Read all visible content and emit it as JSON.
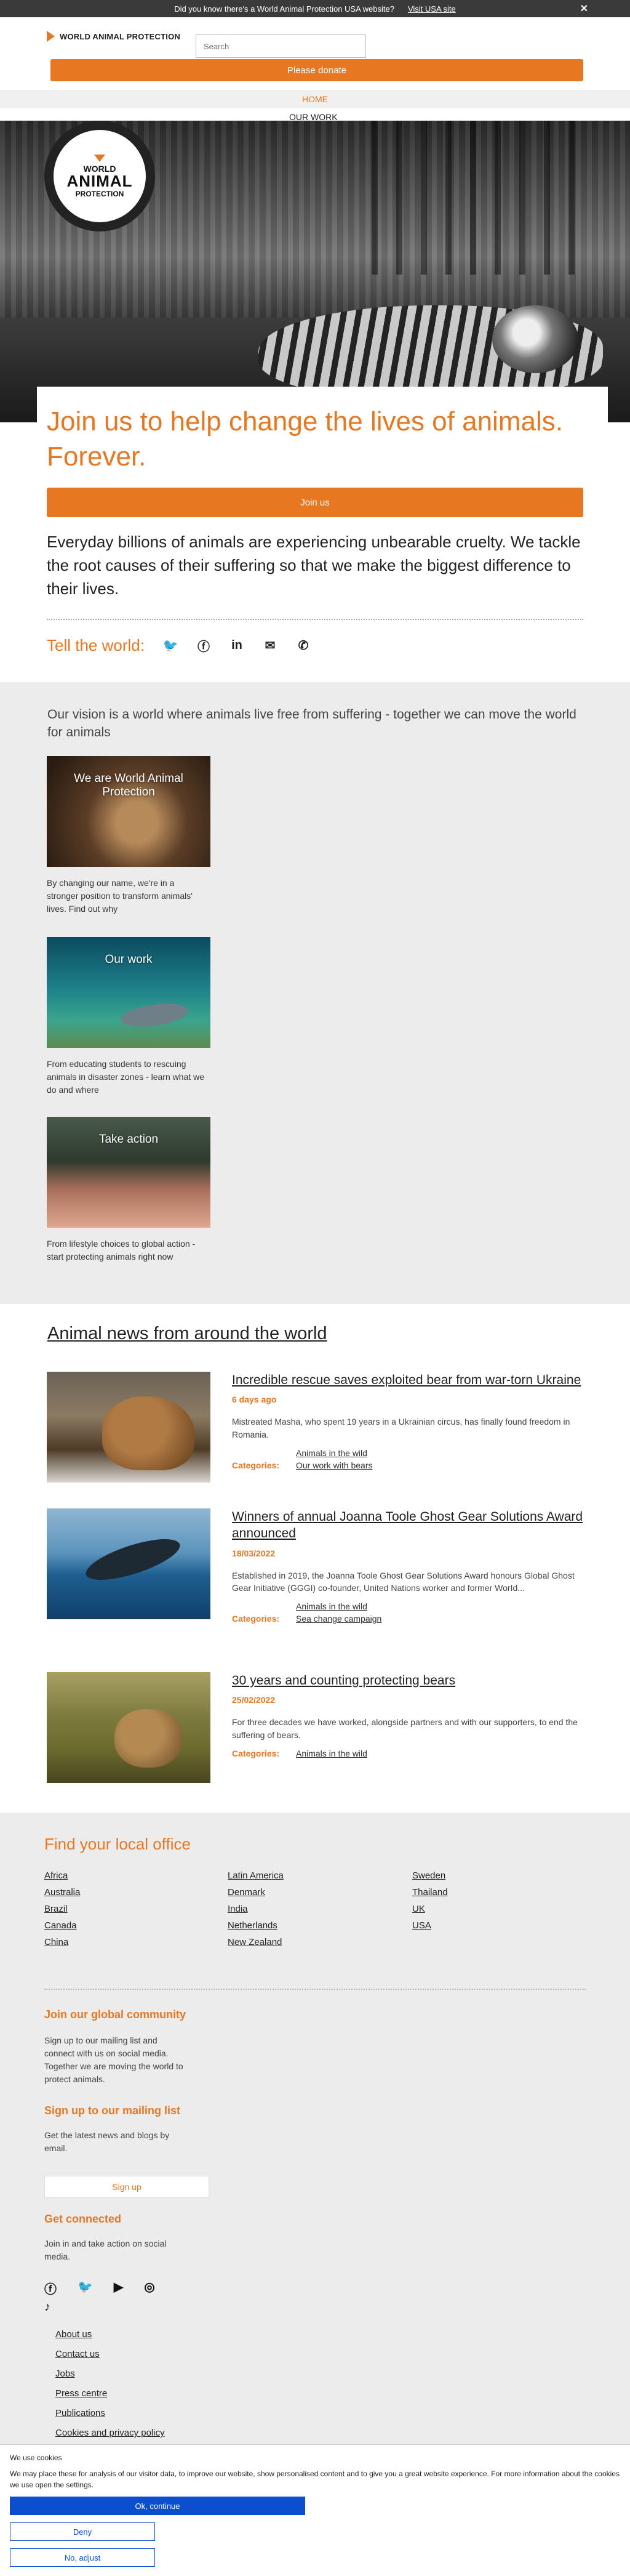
{
  "banner": {
    "message": "Did you know there's a World Animal Protection USA website?",
    "link": "Visit USA site",
    "close": "✕"
  },
  "header": {
    "logo_text": "WORLD ANIMAL PROTECTION",
    "search_placeholder": "Search",
    "donate_label": "Please donate",
    "nav_home": "HOME",
    "nav_our_work": "OUR WORK"
  },
  "hero": {
    "logo_line1": "WORLD",
    "logo_line2": "ANIMAL",
    "logo_line3": "PROTECTION"
  },
  "join": {
    "title": "Join us to help change the lives of animals. Forever.",
    "button": "Join us",
    "text": "Everyday billions of animals are experiencing unbearable cruelty. We tackle the root causes of their suffering so that we make the biggest difference to their lives.",
    "tell_label": "Tell the world:",
    "share_icons": [
      "twitter-icon",
      "facebook-icon",
      "linkedin-icon",
      "email-icon",
      "whatsapp-icon"
    ]
  },
  "vision": {
    "text": "Our vision is a world where animals live free from suffering - together we can move the world for animals",
    "cards": [
      {
        "title": "We are World Animal Protection",
        "caption": "By changing our name, we're in a stronger position to transform animals' lives. Find out why"
      },
      {
        "title": "Our work",
        "caption": "From educating students to rescuing animals in disaster zones - learn what we do and where"
      },
      {
        "title": "Take action",
        "caption": "From lifestyle choices to global action - start protecting animals right now"
      }
    ]
  },
  "news": {
    "heading": "Animal news from around the world",
    "categories_label": "Categories:",
    "items": [
      {
        "title": "Incredible rescue saves exploited bear from war-torn Ukraine",
        "date": "6 days ago",
        "desc": "Mistreated Masha, who spent 19 years in a Ukrainian circus, has finally found freedom in Romania.",
        "categories": [
          "Animals in the wild",
          "Our work with bears"
        ]
      },
      {
        "title": "Winners of annual Joanna Toole Ghost Gear Solutions Award announced",
        "date": "18/03/2022",
        "desc": "Established in 2019, the Joanna Toole Ghost Gear Solutions Award honours Global Ghost Gear Initiative (GGGI) co-founder, United Nations worker and former WorId...",
        "categories": [
          "Animals in the wild",
          "Sea change campaign"
        ]
      },
      {
        "title": "30 years and counting protecting bears",
        "date": "25/02/2022",
        "desc": "For three decades we have worked, alongside partners and with our supporters, to end the suffering of bears.",
        "categories": [
          "Animals in the wild"
        ]
      }
    ]
  },
  "footer": {
    "offices_heading": "Find your local office",
    "offices": [
      "Africa",
      "Latin America",
      "Sweden",
      "Australia",
      "Denmark",
      "Thailand",
      "Brazil",
      "India",
      "UK",
      "Canada",
      "Netherlands",
      "USA",
      "China",
      "New Zealand"
    ],
    "community_heading": "Join our global community",
    "community_text": "Sign up to our mailing list and connect with us on social media. Together we are moving the world to protect animals.",
    "mailing_heading": "Sign up to our mailing list",
    "mailing_text": "Get the latest news and blogs by email.",
    "signup_button": "Sign up",
    "connected_heading": "Get connected",
    "connected_text": "Join in and take action on social media.",
    "social_icons": [
      "facebook-icon",
      "twitter-icon",
      "youtube-icon",
      "instagram-icon",
      "tiktok-icon"
    ],
    "links": [
      "About us",
      "Contact us",
      "Jobs",
      "Press centre",
      "Publications",
      "Cookies and privacy policy"
    ]
  },
  "cookie": {
    "title": "We use cookies",
    "body": "We may place these for analysis of our visitor data, to improve our website, show personalised content and to give you a great website experience. For more information about the cookies we use open the settings.",
    "ok": "Ok, continue",
    "deny": "Deny",
    "adjust": "No, adjust"
  }
}
